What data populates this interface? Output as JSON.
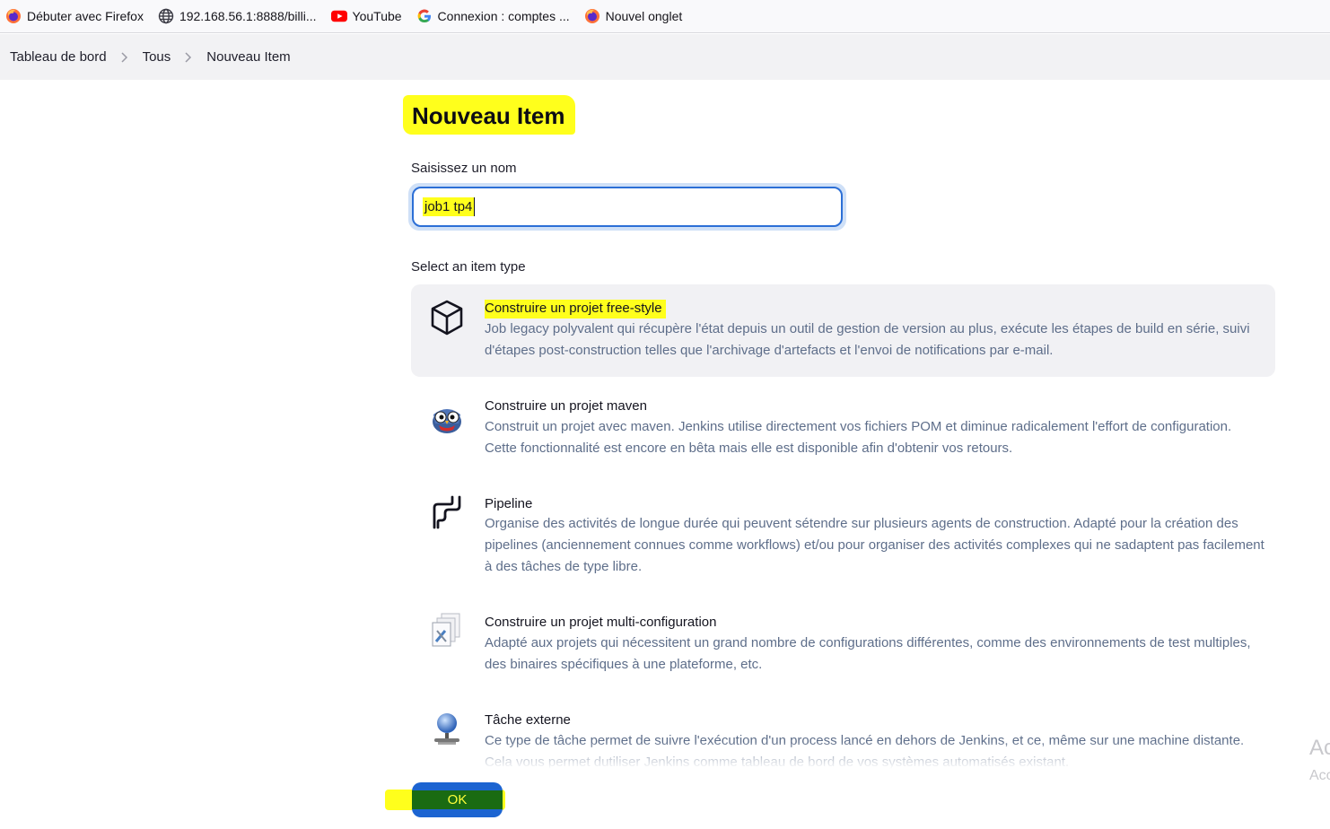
{
  "bookmarks": [
    {
      "label": "Débuter avec Firefox",
      "icon": "firefox-icon"
    },
    {
      "label": "192.168.56.1:8888/billi...",
      "icon": "globe-icon"
    },
    {
      "label": "YouTube",
      "icon": "youtube-icon"
    },
    {
      "label": "Connexion : comptes ...",
      "icon": "google-icon"
    },
    {
      "label": "Nouvel onglet",
      "icon": "firefox-icon"
    }
  ],
  "breadcrumb": {
    "items": [
      "Tableau de bord",
      "Tous",
      "Nouveau Item"
    ]
  },
  "page": {
    "title": "Nouveau Item",
    "name_label": "Saisissez un nom",
    "name_value": "job1 tp4",
    "type_label": "Select an item type"
  },
  "item_types": [
    {
      "name": "Construire un projet free-style",
      "description": "Job legacy polyvalent qui récupère l'état depuis un outil de gestion de version au plus, exécute les étapes de build en série, suivi d'étapes post-construction telles que l'archivage d'artefacts et l'envoi de notifications par e-mail.",
      "icon": "cube-icon",
      "selected": true
    },
    {
      "name": "Construire un projet maven",
      "description": "Construit un projet avec maven. Jenkins utilise directement vos fichiers POM et diminue radicalement l'effort de configuration. Cette fonctionnalité est encore en bêta mais elle est disponible afin d'obtenir vos retours.",
      "icon": "maven-owl-icon",
      "selected": false
    },
    {
      "name": "Pipeline",
      "description": "Organise des activités de longue durée qui peuvent sétendre sur plusieurs agents de construction. Adapté pour la création des pipelines (anciennement connues comme workflows) et/ou pour organiser des activités complexes qui ne sadaptent pas facilement à des tâches de type libre.",
      "icon": "pipeline-icon",
      "selected": false
    },
    {
      "name": "Construire un projet multi-configuration",
      "description": "Adapté aux projets qui nécessitent un grand nombre de configurations différentes, comme des environnements de test multiples, des binaires spécifiques à une plateforme, etc.",
      "icon": "multi-config-icon",
      "selected": false
    },
    {
      "name": "Tâche externe",
      "description": "Ce type de tâche permet de suivre l'exécution d'un process lancé en dehors de Jenkins, et ce, même sur une machine distante. Cela vous permet dutiliser Jenkins comme tableau de bord de vos systèmes automatisés existant.",
      "icon": "globe-monitor-icon",
      "selected": false
    }
  ],
  "ok_label": "OK",
  "watermark": {
    "line1": "Ac",
    "line2": "Acc"
  },
  "colors": {
    "highlight": "#ffff1c",
    "accent": "#1c64d1",
    "desc_text": "#5e6e8a"
  }
}
